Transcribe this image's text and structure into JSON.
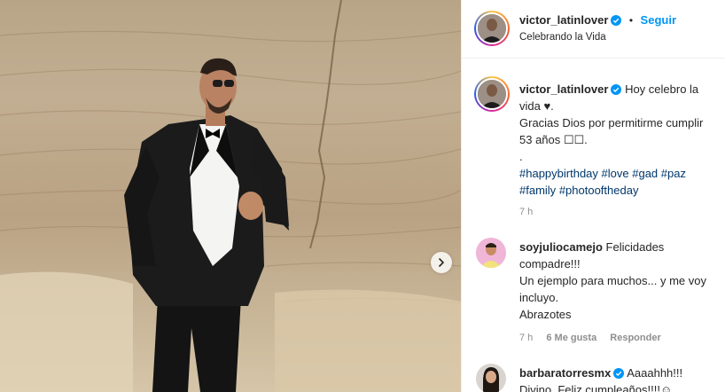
{
  "post": {
    "author": "victor_latinlover",
    "follow_label": "Seguir",
    "separator": "•",
    "location": "Celebrando la Vida"
  },
  "caption": {
    "username": "victor_latinlover",
    "line1": "Hoy celebro la vida ♥.",
    "line2": "Gracias Dios por permitirme cumplir 53 años ☐☐.",
    "line3": ".",
    "hashtags": [
      "#happybirthday",
      "#love",
      "#gad",
      "#paz",
      "#family",
      "#photooftheday"
    ],
    "time": "7 h"
  },
  "comments": [
    {
      "username": "soyjuliocamejo",
      "text1": "Felicidades compadre!!!",
      "text2": "Un ejemplo para muchos... y me voy incluyo.",
      "text3": "Abrazotes",
      "time": "7 h",
      "likes": "6 Me gusta",
      "reply": "Responder"
    },
    {
      "username": "barbaratorresmx",
      "text1": "Aaaahhh!!!",
      "text2": "Divino. Feliz cumpleaños!!!!☺"
    }
  ],
  "colors": {
    "link": "#00376b",
    "follow": "#0095f6",
    "verified": "#0095f6",
    "muted": "#8e8e8e"
  }
}
